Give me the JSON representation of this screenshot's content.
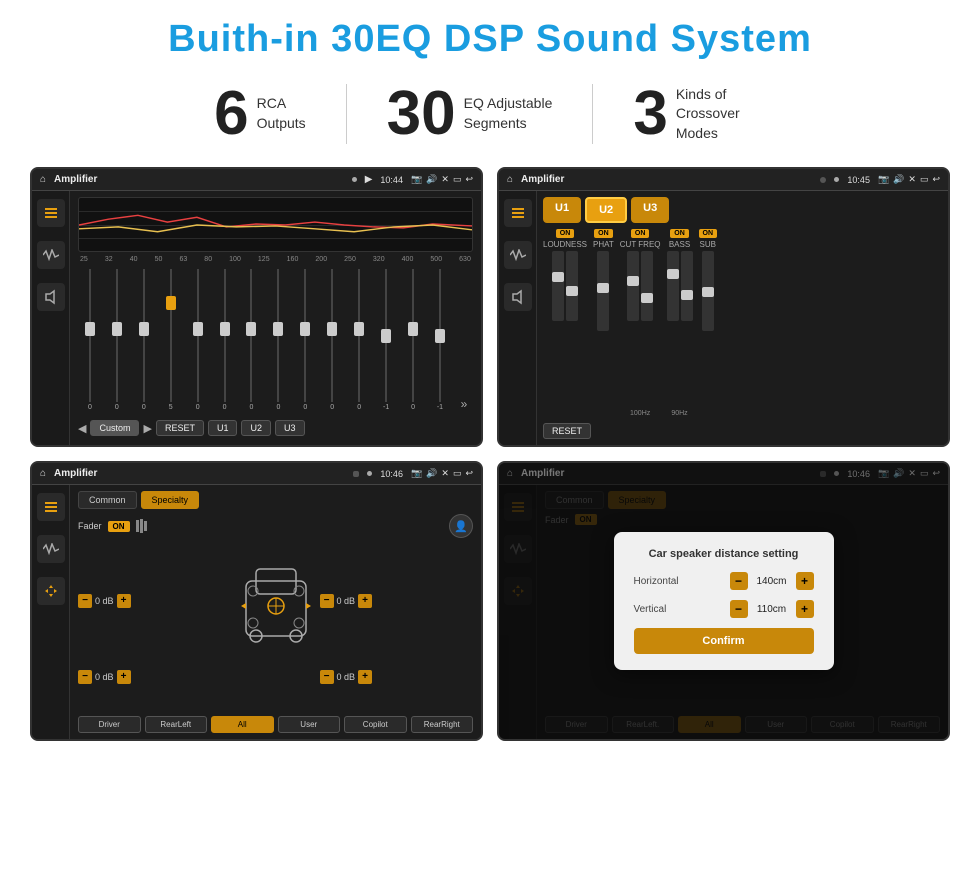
{
  "title": "Buith-in 30EQ DSP Sound System",
  "stats": [
    {
      "number": "6",
      "desc_line1": "RCA",
      "desc_line2": "Outputs"
    },
    {
      "number": "30",
      "desc_line1": "EQ Adjustable",
      "desc_line2": "Segments"
    },
    {
      "number": "3",
      "desc_line1": "Kinds of",
      "desc_line2": "Crossover Modes"
    }
  ],
  "screens": [
    {
      "id": "eq-screen",
      "topbar": {
        "title": "Amplifier",
        "time": "10:44"
      },
      "type": "eq"
    },
    {
      "id": "u-screen",
      "topbar": {
        "title": "Amplifier",
        "time": "10:45"
      },
      "type": "channels"
    },
    {
      "id": "fader-screen",
      "topbar": {
        "title": "Amplifier",
        "time": "10:46"
      },
      "type": "fader"
    },
    {
      "id": "dialog-screen",
      "topbar": {
        "title": "Amplifier",
        "time": "10:46"
      },
      "type": "dialog"
    }
  ],
  "eq": {
    "freq_labels": [
      "25",
      "32",
      "40",
      "50",
      "63",
      "80",
      "100",
      "125",
      "160",
      "200",
      "250",
      "320",
      "400",
      "500",
      "630"
    ],
    "values": [
      "0",
      "0",
      "0",
      "5",
      "0",
      "0",
      "0",
      "0",
      "0",
      "0",
      "0",
      "-1",
      "0",
      "-1"
    ],
    "mode_label": "Custom",
    "buttons": [
      "RESET",
      "U1",
      "U2",
      "U3"
    ]
  },
  "channels": {
    "u_buttons": [
      "U1",
      "U2",
      "U3"
    ],
    "cols": [
      {
        "label": "LOUDNESS",
        "on": true
      },
      {
        "label": "PHAT",
        "on": true
      },
      {
        "label": "CUT FREQ",
        "on": true
      },
      {
        "label": "BASS",
        "on": true
      },
      {
        "label": "SUB",
        "on": true
      }
    ],
    "reset": "RESET"
  },
  "fader": {
    "tabs": [
      "Common",
      "Specialty"
    ],
    "active_tab": "Specialty",
    "fader_label": "Fader",
    "on_badge": "ON",
    "db_values": [
      "0 dB",
      "0 dB",
      "0 dB",
      "0 dB"
    ],
    "bottom_buttons": [
      "Driver",
      "RearLeft",
      "All",
      "User",
      "Copilot",
      "RearRight"
    ]
  },
  "dialog": {
    "title": "Car speaker distance setting",
    "fields": [
      {
        "label": "Horizontal",
        "value": "140cm"
      },
      {
        "label": "Vertical",
        "value": "110cm"
      }
    ],
    "confirm_btn": "Confirm",
    "tabs": [
      "Common",
      "Specialty"
    ],
    "active_tab": "Specialty",
    "bottom_buttons": [
      "Driver",
      "RearLeft.",
      "All",
      "User",
      "Copilot",
      "RearRight"
    ]
  }
}
